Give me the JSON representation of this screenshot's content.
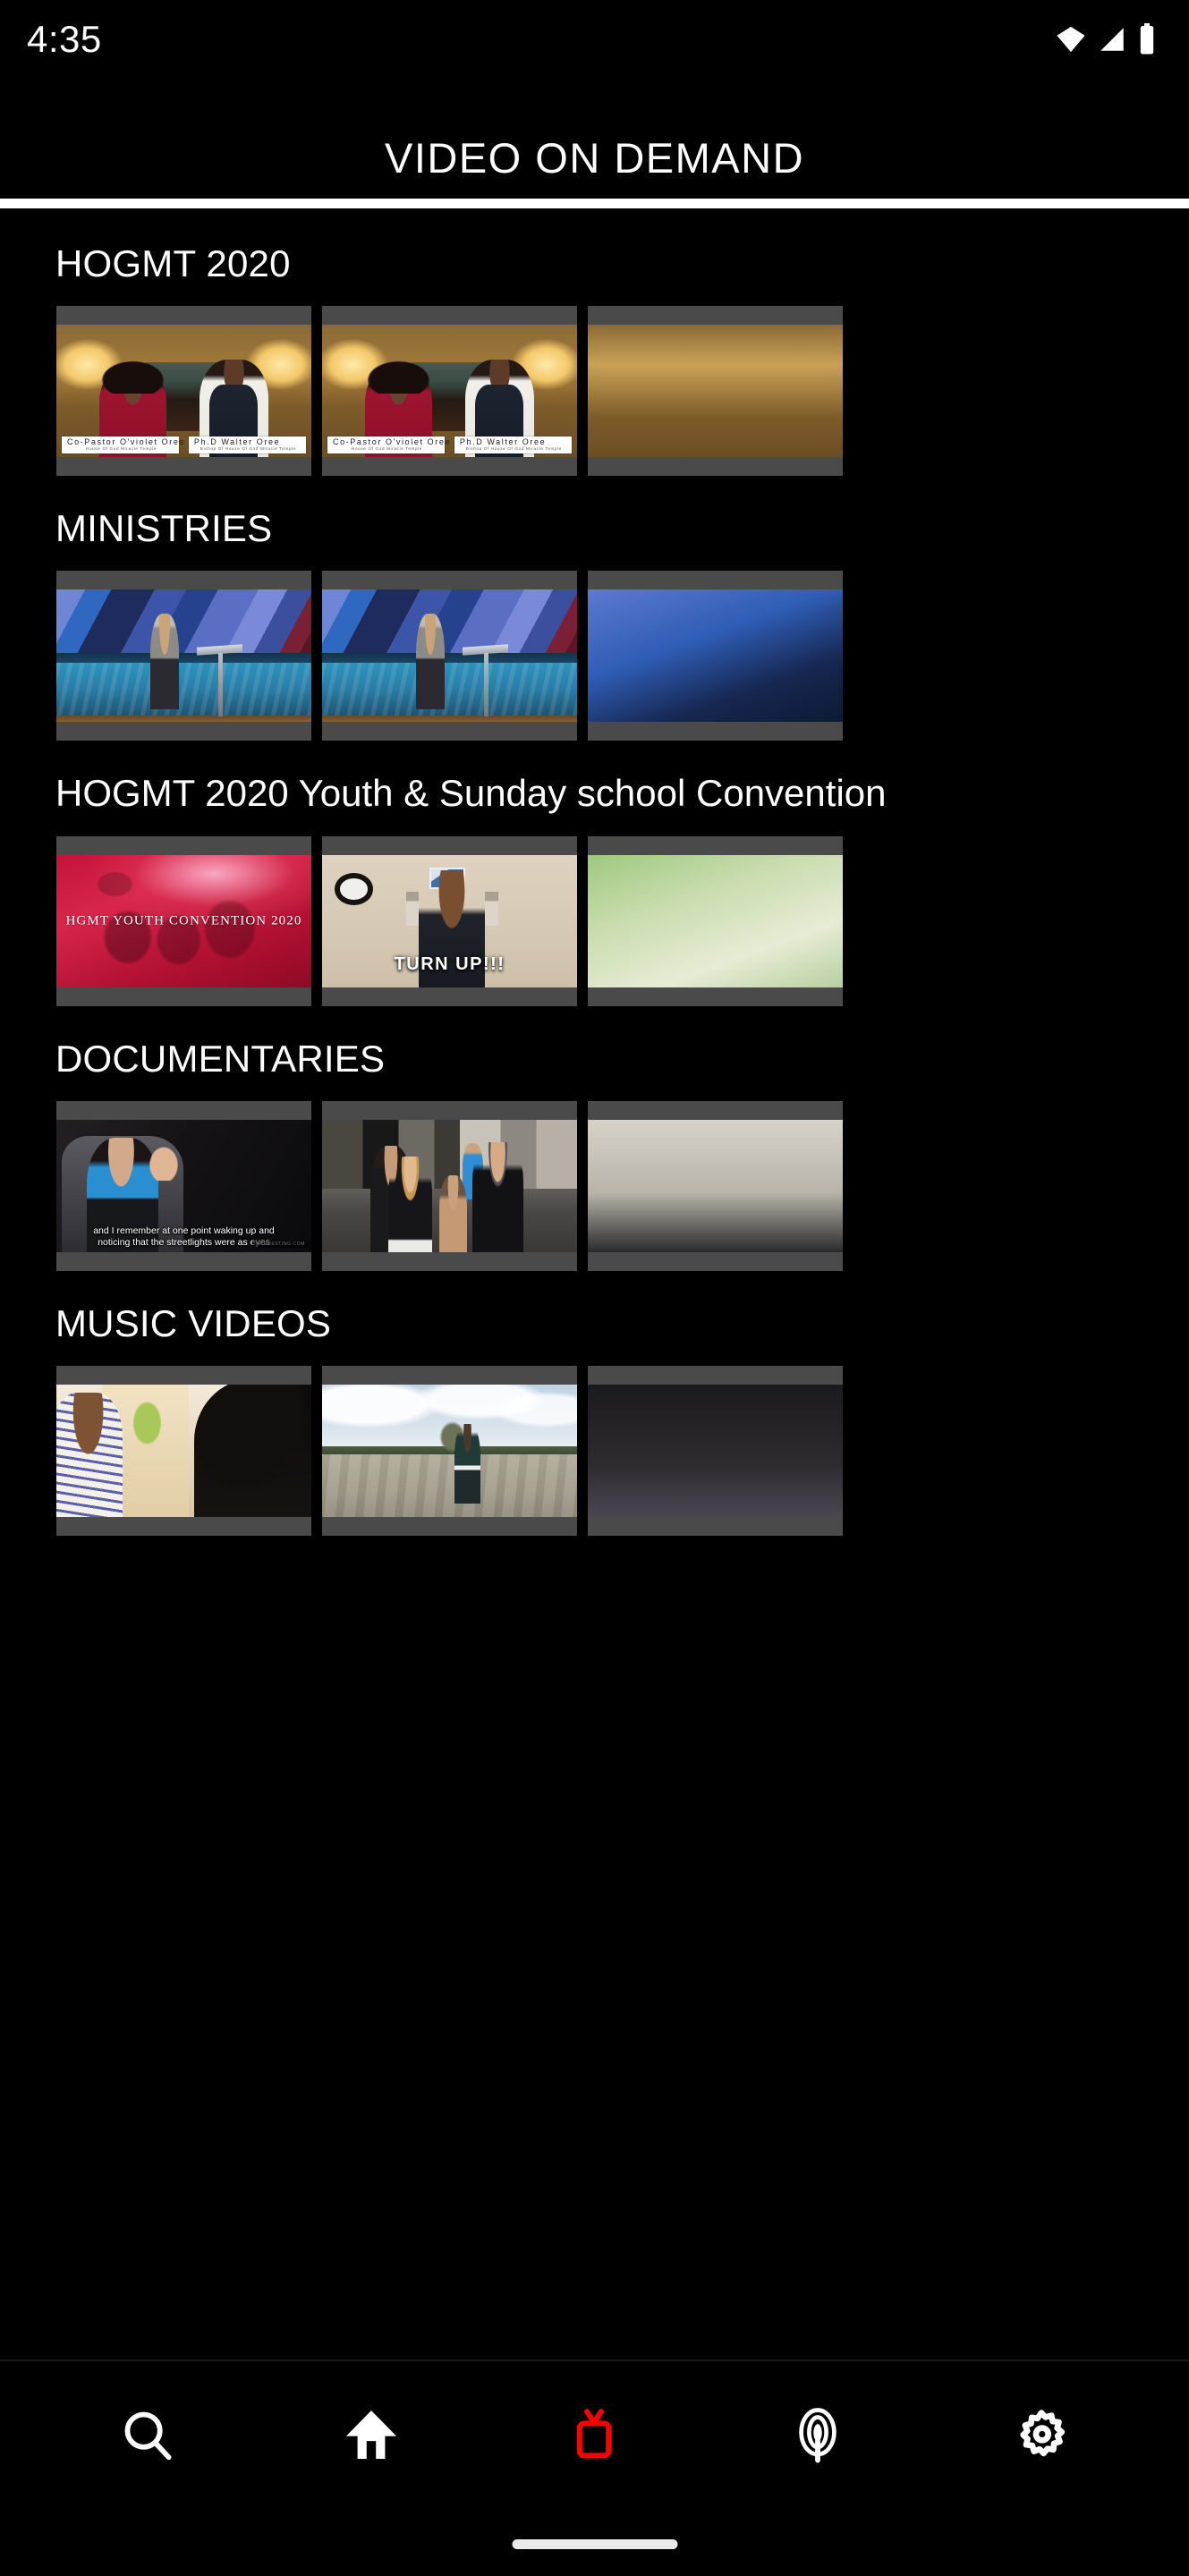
{
  "status_bar": {
    "time": "4:35",
    "icons": [
      "wifi-icon",
      "cellular-signal-icon",
      "battery-icon"
    ]
  },
  "header": {
    "title": "VIDEO ON DEMAND"
  },
  "theme": {
    "background": "#000000",
    "text": "#ffffff",
    "accent": "#ff0000",
    "thumb_letterbox": "#4a4a4a"
  },
  "sections": [
    {
      "title": "HOGMT 2020",
      "items": [
        {
          "art": "art-oree",
          "caption_left_name": "Co-Pastor O'violet Oree",
          "caption_left_sub": "House Of God Miracle Temple",
          "caption_right_name": "Ph.D Walter Oree",
          "caption_right_sub": "Bishop Of House Of God Miracle Temple"
        },
        {
          "art": "art-oree",
          "caption_left_name": "Co-Pastor O'violet Oree",
          "caption_left_sub": "House Of God Miracle Temple",
          "caption_right_name": "Ph.D Walter Oree",
          "caption_right_sub": "Bishop Of House Of God Miracle Temple"
        },
        {
          "art": "art-peek-oree",
          "partial": true
        }
      ]
    },
    {
      "title": "MINISTRIES",
      "items": [
        {
          "art": "art-min"
        },
        {
          "art": "art-min"
        },
        {
          "art": "art-peek-min",
          "partial": true
        }
      ]
    },
    {
      "title": "HOGMT 2020 Youth & Sunday school Convention",
      "items": [
        {
          "art": "art-youth",
          "overlay": "HGMT YOUTH CONVENTION 2020"
        },
        {
          "art": "art-turnup",
          "overlay": "TURN UP!!!"
        },
        {
          "art": "art-peek-map",
          "partial": true
        }
      ]
    },
    {
      "title": "DOCUMENTARIES",
      "items": [
        {
          "art": "art-doc",
          "subtitle_line1": "and I remember at one point waking up and",
          "subtitle_line2": "noticing that the streetlights were as eyes",
          "watermark": "INTERESTING.COM"
        },
        {
          "art": "art-street"
        },
        {
          "art": "art-peek-light",
          "partial": true
        }
      ]
    },
    {
      "title": "MUSIC VIDEOS",
      "items": [
        {
          "art": "art-mv1"
        },
        {
          "art": "art-mv2"
        },
        {
          "art": "art-peek-dark",
          "partial": true
        }
      ]
    }
  ],
  "bottom_nav": {
    "items": [
      {
        "name": "search-icon",
        "label": "Search",
        "active": false
      },
      {
        "name": "home-icon",
        "label": "Home",
        "active": false
      },
      {
        "name": "tv-icon",
        "label": "TV",
        "active": true
      },
      {
        "name": "podcast-icon",
        "label": "Podcast",
        "active": false
      },
      {
        "name": "gear-icon",
        "label": "Settings",
        "active": false
      }
    ],
    "active_color": "#ff0000",
    "inactive_color": "#ffffff"
  }
}
